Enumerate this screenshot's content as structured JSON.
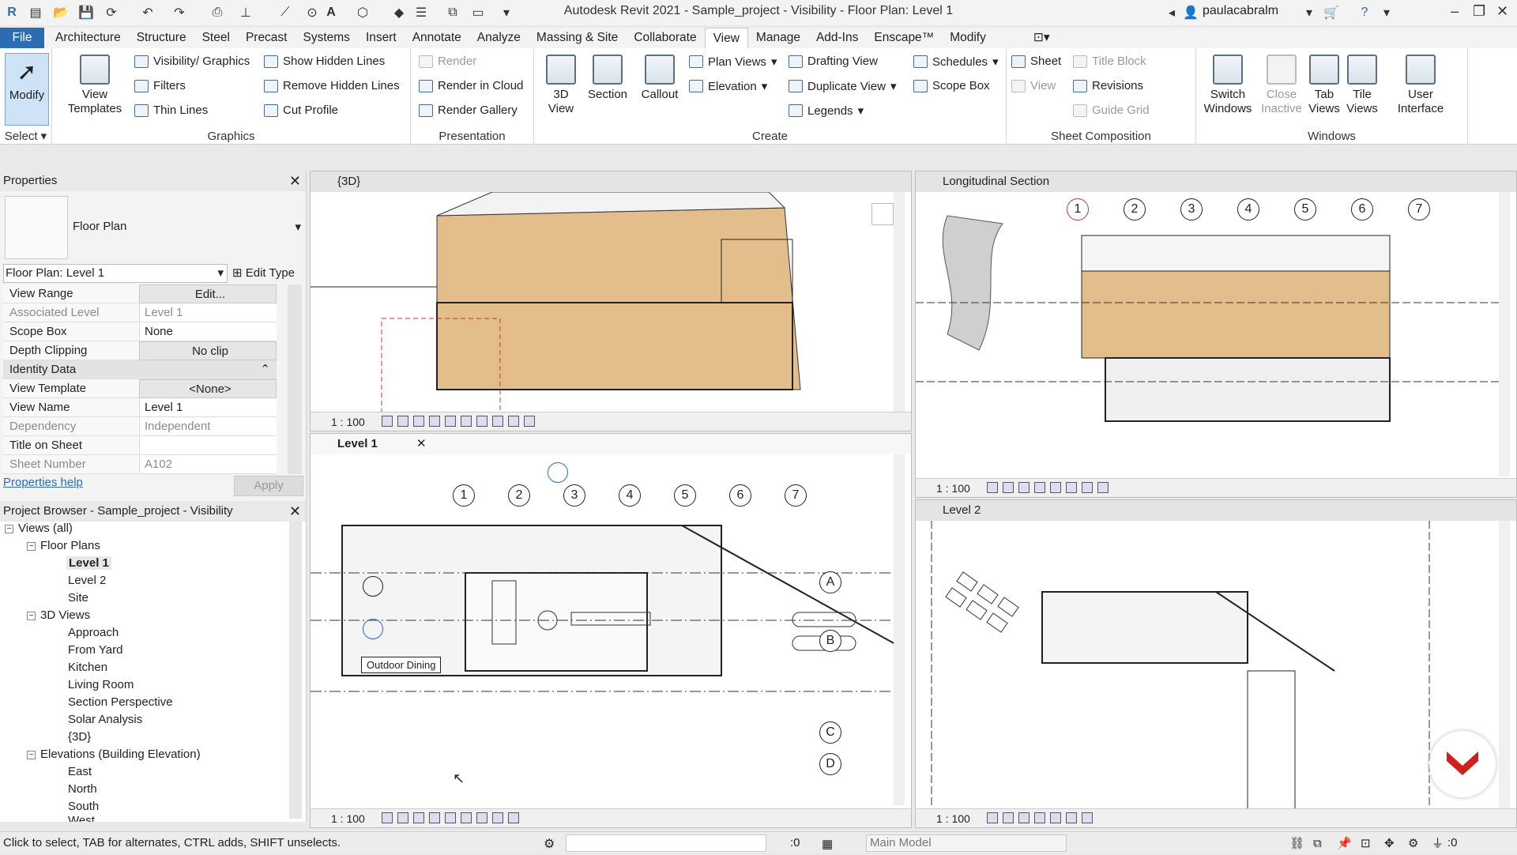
{
  "app_title": "Autodesk Revit 2021 - Sample_project - Visibility - Floor Plan: Level 1",
  "user": "paulacabralm",
  "menu_tabs": [
    "File",
    "Architecture",
    "Structure",
    "Steel",
    "Precast",
    "Systems",
    "Insert",
    "Annotate",
    "Analyze",
    "Massing & Site",
    "Collaborate",
    "View",
    "Manage",
    "Add-Ins",
    "Enscape™",
    "Modify"
  ],
  "active_tab": "View",
  "ribbon": {
    "modify": "Modify",
    "select": "Select",
    "view_templates": "View Templates",
    "graphics": {
      "title": "Graphics",
      "visibility": "Visibility/ Graphics",
      "filters": "Filters",
      "thin_lines": "Thin Lines",
      "show_hidden": "Show  Hidden Lines",
      "remove_hidden": "Remove  Hidden Lines",
      "cut_profile": "Cut  Profile"
    },
    "presentation": {
      "title": "Presentation",
      "render": "Render",
      "render_cloud": "Render  in Cloud",
      "render_gallery": "Render  Gallery"
    },
    "create": {
      "title": "Create",
      "view_3d": "3D View",
      "section": "Section",
      "callout": "Callout",
      "plan_views": "Plan  Views",
      "elevation": "Elevation",
      "drafting": "Drafting  View",
      "duplicate": "Duplicate  View",
      "legends": "Legends",
      "schedules": "Schedules",
      "scope_box": "Scope  Box"
    },
    "sheet": {
      "title": "Sheet Composition",
      "sheet": "Sheet",
      "view": "View",
      "title_block": "Title  Block",
      "revisions": "Revisions",
      "guide_grid": "Guide  Grid"
    },
    "windows": {
      "title": "Windows",
      "switch": "Switch Windows",
      "close_inactive": "Close Inactive",
      "tab_views": "Tab Views",
      "tile_views": "Tile Views",
      "user_interface": "User Interface"
    }
  },
  "properties": {
    "header": "Properties",
    "type": "Floor Plan",
    "selector": "Floor Plan: Level 1",
    "edit_type": "Edit Type",
    "rows": [
      {
        "k": "View Range",
        "v": "Edit..."
      },
      {
        "k": "Associated Level",
        "v": "Level 1"
      },
      {
        "k": "Scope Box",
        "v": "None"
      },
      {
        "k": "Depth Clipping",
        "v": "No clip"
      },
      {
        "k": "Identity Data",
        "v": ""
      },
      {
        "k": "View Template",
        "v": "<None>"
      },
      {
        "k": "View Name",
        "v": "Level 1"
      },
      {
        "k": "Dependency",
        "v": "Independent"
      },
      {
        "k": "Title on Sheet",
        "v": ""
      },
      {
        "k": "Sheet Number",
        "v": "A102"
      }
    ],
    "help": "Properties help",
    "apply": "Apply"
  },
  "browser": {
    "header": "Project Browser - Sample_project - Visibility",
    "nodes": [
      "Views (all)",
      "Floor Plans",
      "Level 1",
      "Level 2",
      "Site",
      "3D Views",
      "Approach",
      "From Yard",
      "Kitchen",
      "Living Room",
      "Section Perspective",
      "Solar Analysis",
      "{3D}",
      "Elevations (Building Elevation)",
      "East",
      "North",
      "South",
      "West"
    ]
  },
  "views": {
    "v3d": {
      "title": "{3D}",
      "scale": "1 : 100"
    },
    "section": {
      "title": "Longitudinal Section",
      "scale": "1 : 100"
    },
    "level1": {
      "title": "Level 1",
      "scale": "1 : 100",
      "label": "Outdoor Dining"
    },
    "level2": {
      "title": "Level 2",
      "scale": "1 : 100"
    }
  },
  "grid_numbers": [
    "1",
    "2",
    "3",
    "4",
    "5",
    "6",
    "7"
  ],
  "grid_letters": [
    "A",
    "B",
    "C",
    "D"
  ],
  "status": {
    "hint": "Click to select, TAB for alternates, CTRL adds, SHIFT unselects.",
    "zero": ":0",
    "model": "Main Model",
    "filter": ":0"
  }
}
